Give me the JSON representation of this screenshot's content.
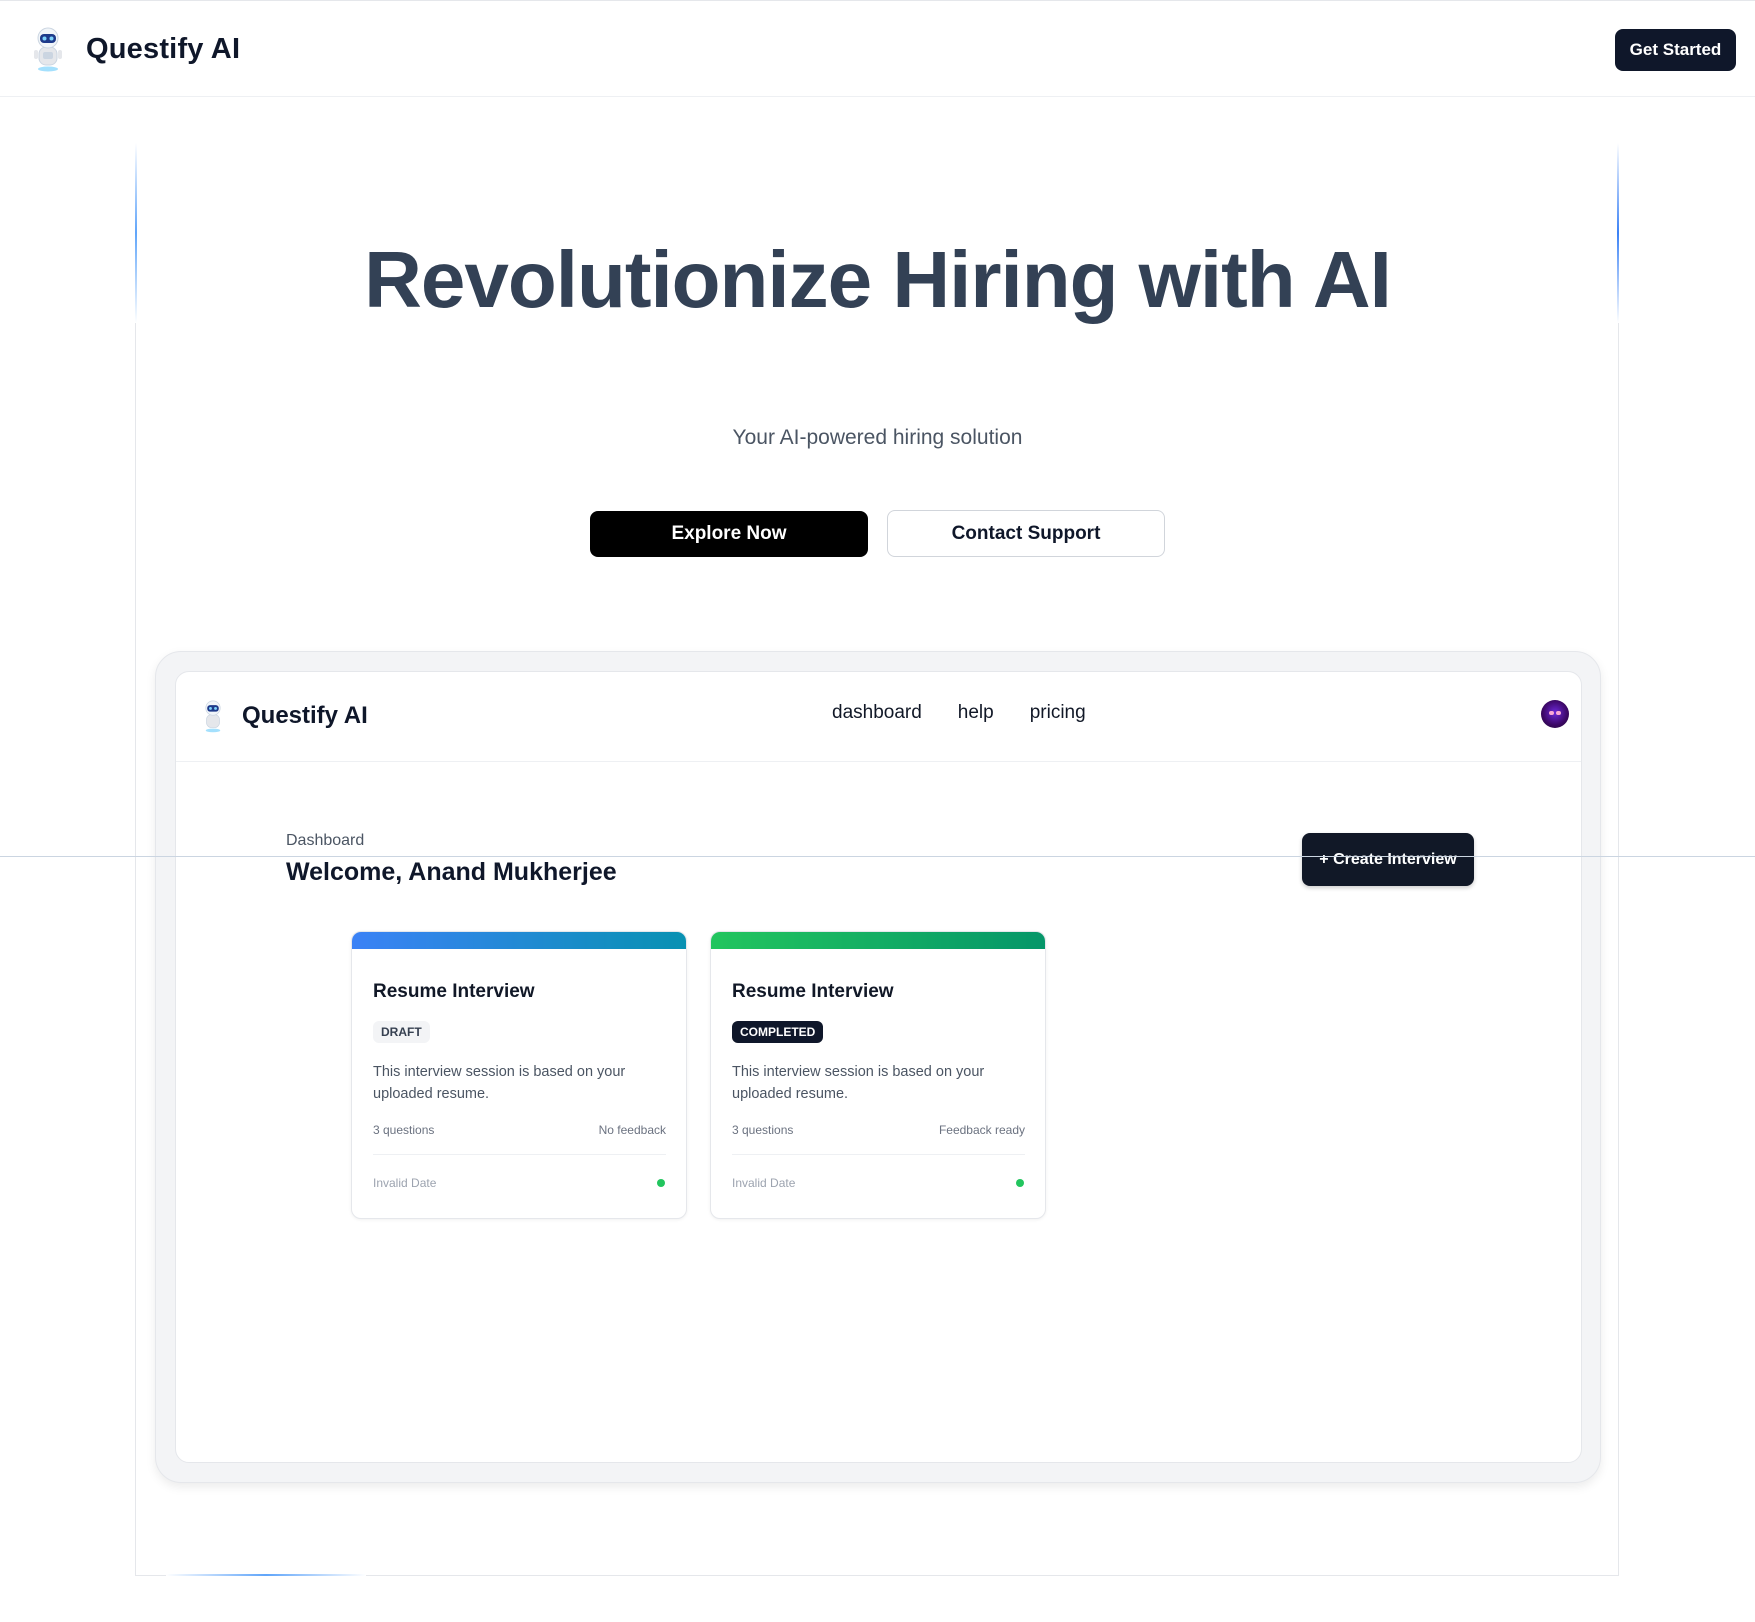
{
  "header": {
    "brand": "Questify AI",
    "get_started_label": "Get Started"
  },
  "hero": {
    "title": "Revolutionize Hiring with AI",
    "subtitle": "Your AI-powered hiring solution",
    "explore_label": "Explore Now",
    "contact_label": "Contact Support"
  },
  "mockup": {
    "brand": "Questify AI",
    "nav_links": [
      "dashboard",
      "help",
      "pricing"
    ],
    "dashboard_label": "Dashboard",
    "welcome": "Welcome, Anand Mukherjee",
    "create_label": "+ Create Interview",
    "cards": [
      {
        "title": "Resume Interview",
        "status": "DRAFT",
        "description": "This interview session is based on your uploaded resume.",
        "questions": "3 questions",
        "feedback": "No feedback",
        "date": "Invalid Date",
        "accent": [
          "#3b82f6",
          "#0891b2"
        ]
      },
      {
        "title": "Resume Interview",
        "status": "COMPLETED",
        "description": "This interview session is based on your uploaded resume.",
        "questions": "3 questions",
        "feedback": "Feedback ready",
        "date": "Invalid Date",
        "accent": [
          "#22c55e",
          "#059669"
        ]
      }
    ]
  },
  "colors": {
    "primary_dark": "#0f172a",
    "hero_text": "#334155",
    "status_dot": "#22c55e"
  },
  "icons": {
    "logo": "robot-icon",
    "avatar": "user-avatar"
  }
}
